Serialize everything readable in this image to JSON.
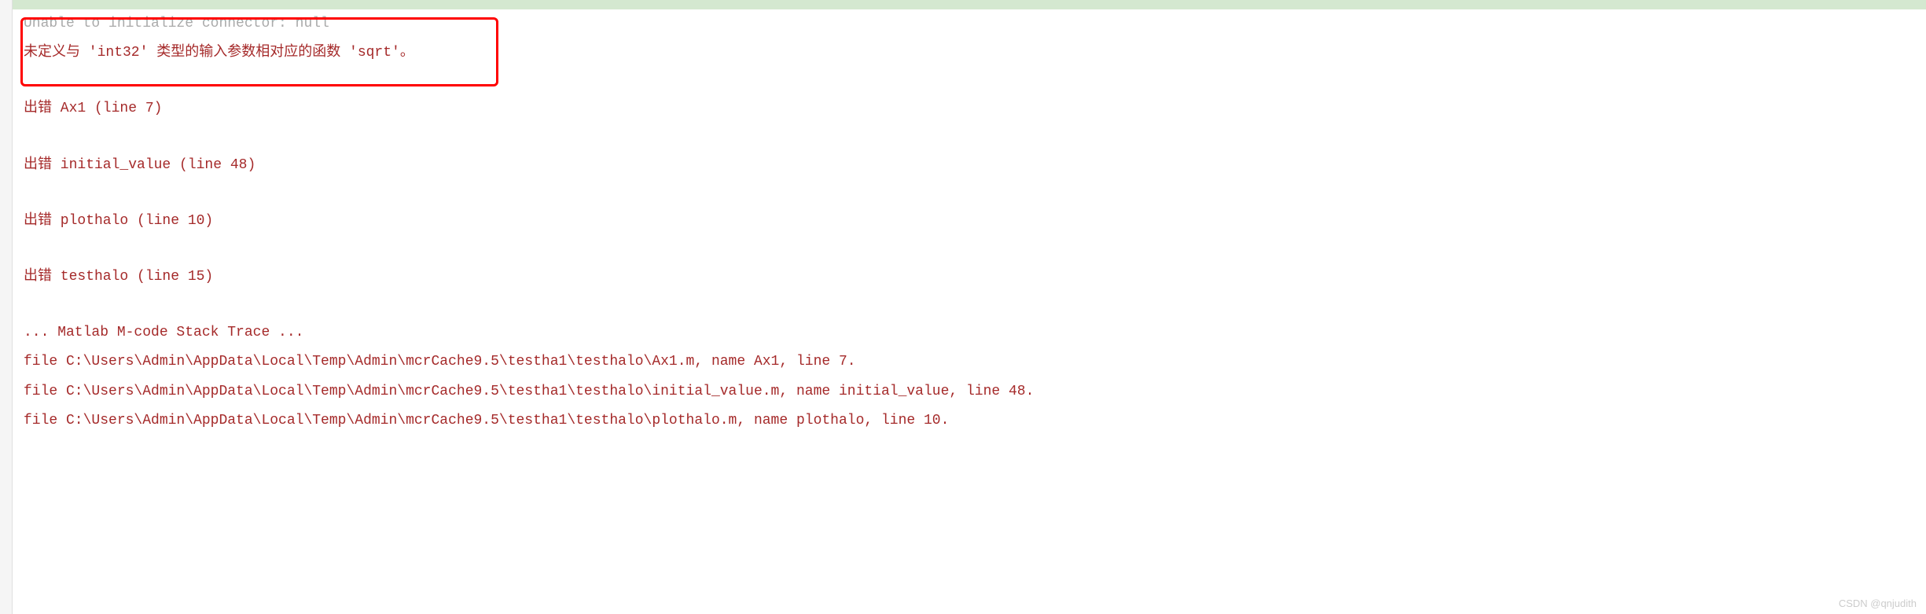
{
  "topBar": {
    "truncatedPath": ""
  },
  "errorLines": {
    "unableLine": "Unable to initialize connector: null",
    "undefinedFunction": "未定义与 'int32' 类型的输入参数相对应的函数 'sqrt'。"
  },
  "stackErrors": [
    {
      "label": "出错 Ax1 (line 7)"
    },
    {
      "label": "出错 initial_value (line 48)"
    },
    {
      "label": "出错 plothalo (line 10)"
    },
    {
      "label": "出错 testhalo (line 15)"
    }
  ],
  "stackTrace": {
    "header": "... Matlab M-code Stack Trace ...",
    "files": [
      "file C:\\Users\\Admin\\AppData\\Local\\Temp\\Admin\\mcrCache9.5\\testha1\\testhalo\\Ax1.m, name Ax1, line 7.",
      "file C:\\Users\\Admin\\AppData\\Local\\Temp\\Admin\\mcrCache9.5\\testha1\\testhalo\\initial_value.m, name initial_value, line 48.",
      "file C:\\Users\\Admin\\AppData\\Local\\Temp\\Admin\\mcrCache9.5\\testha1\\testhalo\\plothalo.m, name plothalo, line 10."
    ]
  },
  "watermark": "CSDN @qnjudith"
}
